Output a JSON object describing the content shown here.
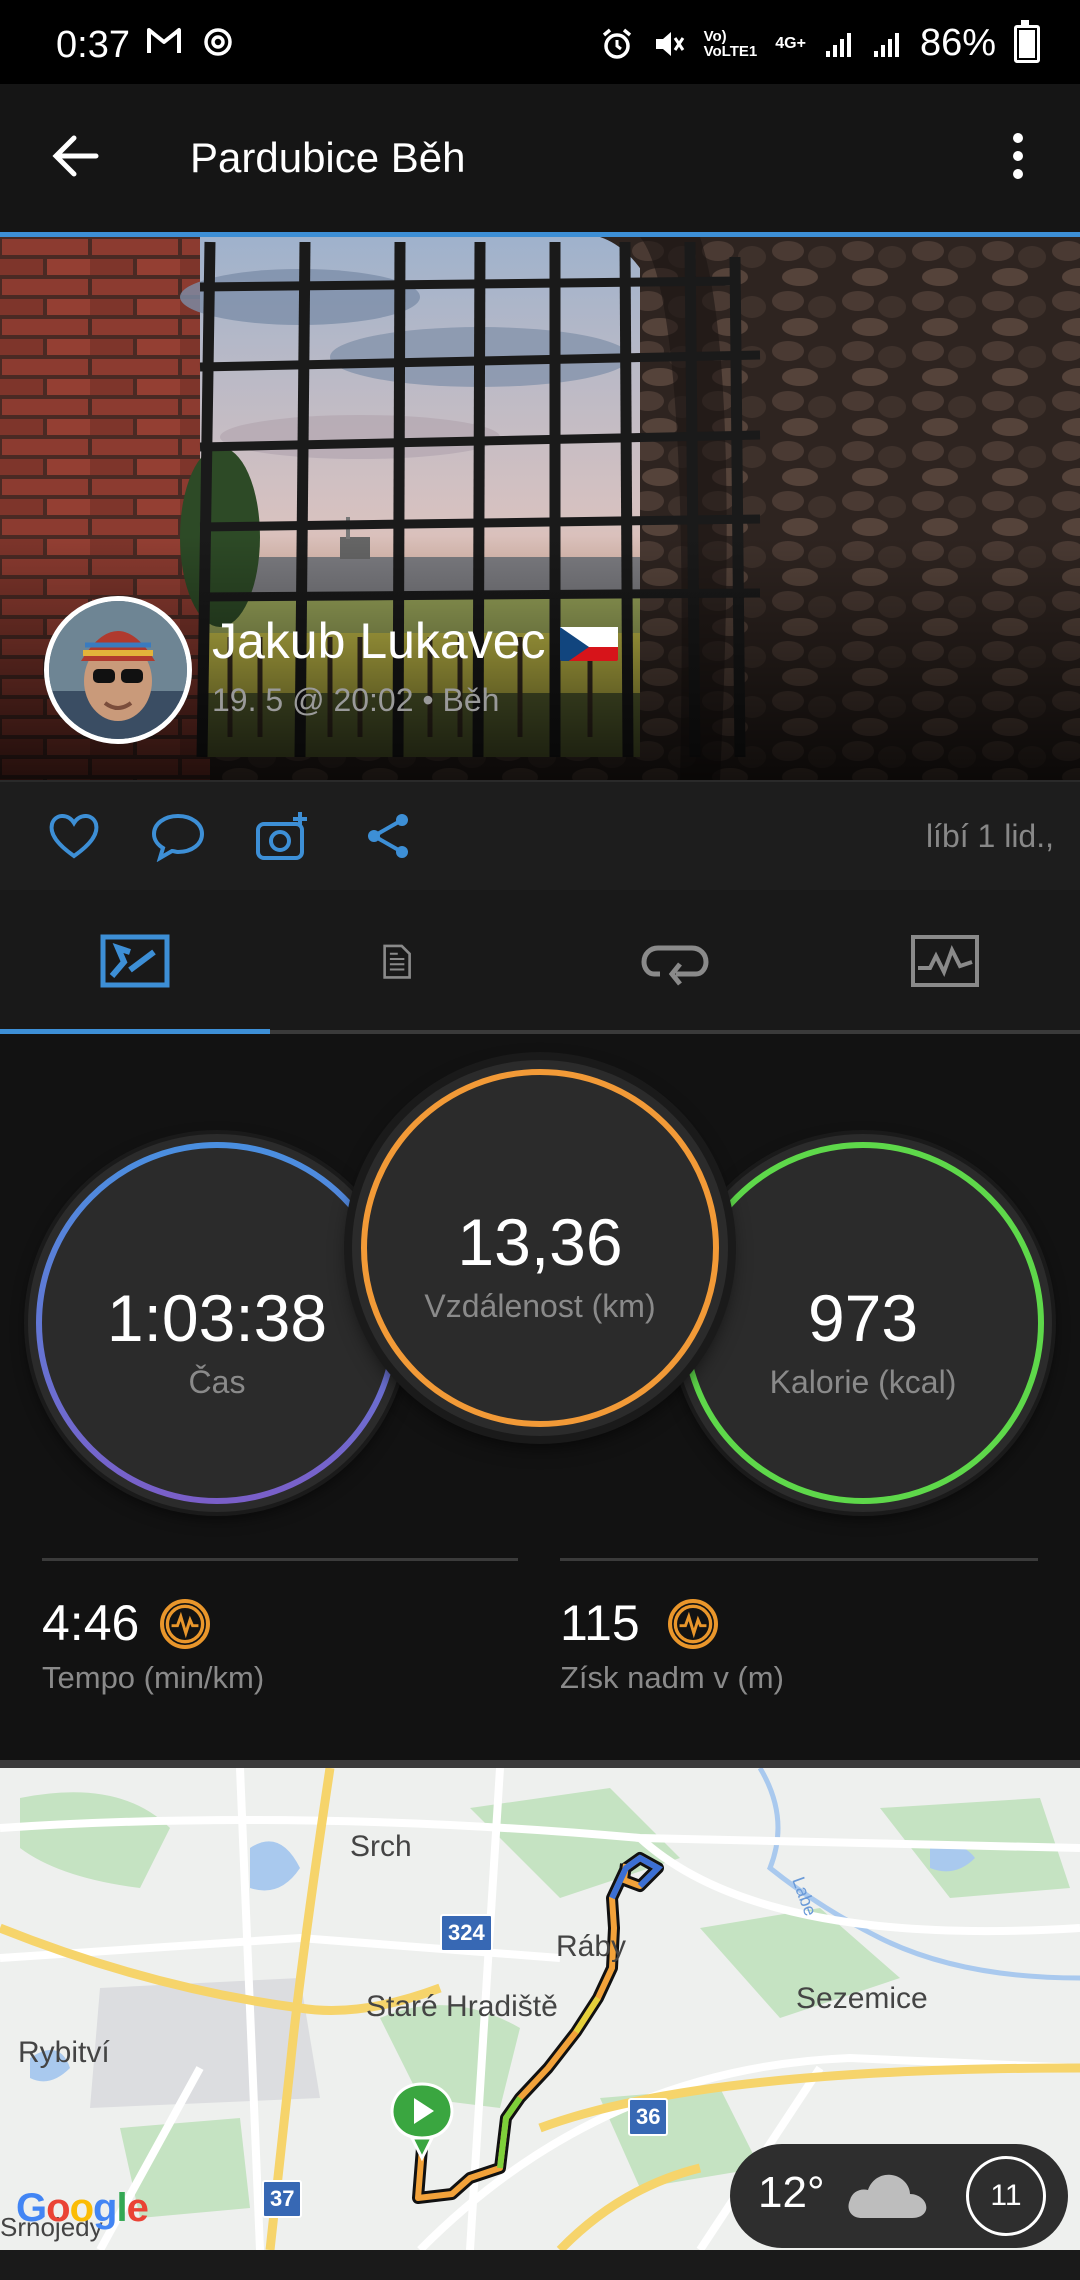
{
  "status_bar": {
    "time": "0:37",
    "network_1": "VoLTE1",
    "network_2": "4G+",
    "battery_percent": "86%",
    "battery_level": 0.86
  },
  "app_bar": {
    "title": "Pardubice Běh"
  },
  "activity": {
    "owner_name": "Jakub Lukavec",
    "meta": "19. 5 @ 20:02 • Běh",
    "likes_text": "líbí 1 lid.,"
  },
  "tabs": [
    {
      "id": "summary",
      "active": true
    },
    {
      "id": "details",
      "active": false
    },
    {
      "id": "laps",
      "active": false
    },
    {
      "id": "charts",
      "active": false
    }
  ],
  "stats": {
    "time": {
      "value": "1:03:38",
      "label": "Čas"
    },
    "distance": {
      "value": "13,36",
      "label": "Vzdálenost (km)"
    },
    "calories": {
      "value": "973",
      "label": "Kalorie (kcal)"
    },
    "pace": {
      "value": "4:46",
      "label": "Tempo (min/km)"
    },
    "elevation": {
      "value": "115",
      "label": "Získ nadm v (m)"
    }
  },
  "map": {
    "labels": {
      "srch": "Srch",
      "raby": "Ráby",
      "labe": "Labe",
      "stare_hradiste": "Staré Hradiště",
      "sezemice": "Sezemice",
      "rybitvi": "Rybitví",
      "srnojedy": "Srnojedy"
    },
    "road_shields": [
      "324",
      "36",
      "37"
    ],
    "attribution": "Google"
  },
  "weather": {
    "temperature": "12°",
    "badge": "11"
  },
  "colors": {
    "accent_blue": "#3d8fd6",
    "distance_orange": "#f29a37",
    "calories_green": "#5ed84a",
    "time_blue": "#4a8fe0",
    "time_purple": "#7a5fc9",
    "hr_icon_orange": "#e9962b"
  }
}
